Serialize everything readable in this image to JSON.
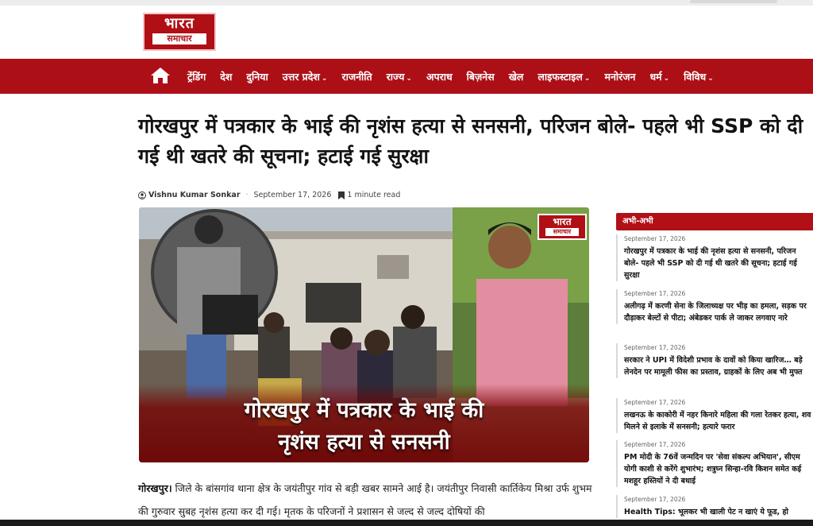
{
  "brand": {
    "line1": "भारत",
    "line2": "समाचार"
  },
  "nav": {
    "home_icon": "home-icon",
    "items": [
      {
        "label": "ट्रेंडिंग",
        "chev": ""
      },
      {
        "label": "देश",
        "chev": ""
      },
      {
        "label": "दुनिया",
        "chev": ""
      },
      {
        "label": "उत्तर प्रदेश",
        "chev": "⌄"
      },
      {
        "label": "राजनीति",
        "chev": ""
      },
      {
        "label": "राज्य",
        "chev": "⌄"
      },
      {
        "label": "अपराध",
        "chev": ""
      },
      {
        "label": "बिज़नेस",
        "chev": ""
      },
      {
        "label": "खेल",
        "chev": ""
      },
      {
        "label": "लाइफस्टाइल",
        "chev": "⌄"
      },
      {
        "label": "मनोरंजन",
        "chev": ""
      },
      {
        "label": "धर्म",
        "chev": "⌄"
      },
      {
        "label": "विविध",
        "chev": "⌄"
      }
    ]
  },
  "article": {
    "title": "गोरखपुर में पत्रकार के भाई की नृशंस हत्या से सनसनी, परिजन बोले- पहले भी SSP को दी गई थी खतरे की सूचना; हटाई गई सुरक्षा",
    "author": "Vishnu Kumar Sonkar",
    "date": "September 17, 2026",
    "read_time": "1 minute read",
    "image_caption_line1": "गोरखपुर में पत्रकार के भाई की",
    "image_caption_line2": "नृशंस हत्या से सनसनी",
    "lead_location": "गोरखपुर।",
    "lead_text": " जिले के बांसगांव थाना क्षेत्र के जयंतीपुर गांव से बड़ी खबर सामने आई है। जयंतीपुर निवासी कार्तिकेय मिश्रा उर्फ शुभम की गुरुवार सुबह नृशंस हत्या कर दी गई। मृतक के परिजनों ने प्रशासन से जल्द से जल्द दोषियों की"
  },
  "sidebar": {
    "heading": "अभी-अभी",
    "items": [
      {
        "date": "September 17, 2026",
        "text": "गोरखपुर में पत्रकार के भाई की नृशंस हत्या से सनसनी, परिजन बोले- पहले भी SSP को दी गई थी खतरे की सूचना; हटाई गई सुरक्षा"
      },
      {
        "date": "September 17, 2026",
        "text": "अलीगढ़ में करणी सेना के जिलाध्यक्ष पर भीड़ का हमला, सड़क पर दौड़ाकर बेल्टों से पीटा; अंबेडकर पार्क ले जाकर लगवाए नारे"
      },
      {
        "date": "September 17, 2026",
        "text": "सरकार ने UPI में विदेशी प्रभाव के दावों को किया खारिज… बड़े लेनदेन पर मामूली फीस का प्रस्ताव, ग्राहकों के लिए अब भी मुफ्त"
      },
      {
        "date": "September 17, 2026",
        "text": "लखनऊ के काकोरी में नहर किनारे महिला की गला रेतकर हत्या, शव मिलने से इलाके में सनसनी; हत्यारे फरार"
      },
      {
        "date": "September 17, 2026",
        "text": "PM मोदी के 76वें जन्मदिन पर 'सेवा संकल्प अभियान', सीएम योगी काशी से करेंगे शुभारंभ; शत्रुघ्न सिन्हा-रवि किशन समेत कई मशहूर हस्तियों ने दी बधाई"
      },
      {
        "date": "September 17, 2026",
        "text": "Health Tips: भूलकर भी खाली पेट न खाएं ये फूड, हो"
      }
    ]
  }
}
